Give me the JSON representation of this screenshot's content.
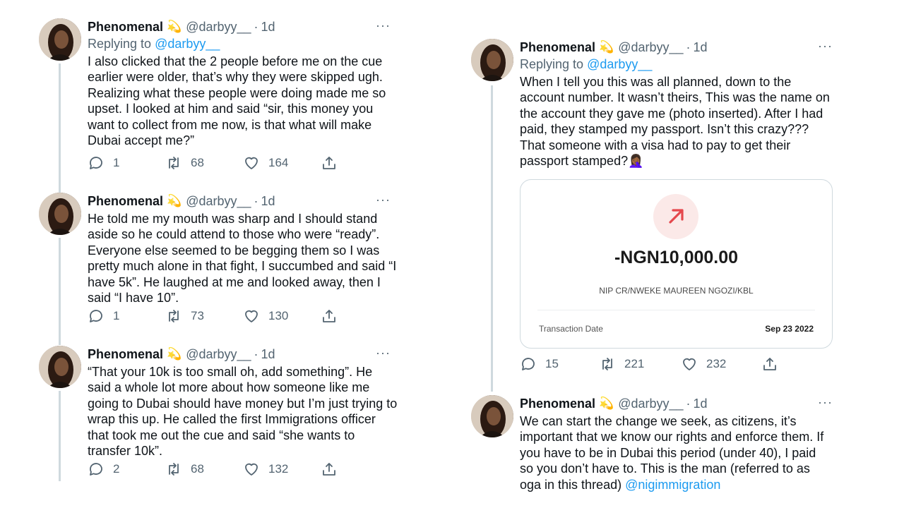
{
  "left_tweets": [
    {
      "name": "Phenomenal",
      "badge": "💫",
      "handle": "@darbyy__",
      "time": "1d",
      "replying_prefix": "Replying to ",
      "replying_to": "@darbyy__",
      "text": "I also clicked that the 2 people before me on the cue earlier were older, that’s why they were skipped ugh. Realizing what these people were doing made me so upset. I looked at him and said “sir, this money you want to collect from me now, is that what will make Dubai accept me?”",
      "replies": "1",
      "retweets": "68",
      "likes": "164"
    },
    {
      "name": "Phenomenal",
      "badge": "💫",
      "handle": "@darbyy__",
      "time": "1d",
      "text": "He told me my mouth was sharp and I should stand aside so he could attend to those who were “ready”. Everyone else seemed to be begging them so I was pretty much alone in that fight, I succumbed and said “I have 5k”. He laughed at me and looked away, then I said “I have 10”.",
      "replies": "1",
      "retweets": "73",
      "likes": "130"
    },
    {
      "name": "Phenomenal",
      "badge": "💫",
      "handle": "@darbyy__",
      "time": "1d",
      "text": "“That your 10k is too small oh, add something”. He said a whole lot more about how someone like me going to Dubai should have money but I’m just trying to wrap this up. He called the first Immigrations officer that took me out the cue and said “she wants to transfer 10k”.",
      "replies": "2",
      "retweets": "68",
      "likes": "132"
    }
  ],
  "right_tweets": [
    {
      "name": "Phenomenal",
      "badge": "💫",
      "handle": "@darbyy__",
      "time": "1d",
      "replying_prefix": "Replying to ",
      "replying_to": "@darbyy__",
      "text": "When I tell you this was all planned, down to the account number. It wasn’t theirs, This was the name on the account they gave me (photo inserted). After I had paid, they stamped my passport. Isn’t this crazy??? That someone with a visa had to pay to get their passport stamped?🤦🏾‍♀️",
      "card": {
        "amount": "-NGN10,000.00",
        "reference": "NIP CR/NWEKE MAUREEN NGOZI/KBL",
        "date_label": "Transaction Date",
        "date_value": "Sep 23 2022"
      },
      "replies": "15",
      "retweets": "221",
      "likes": "232"
    },
    {
      "name": "Phenomenal",
      "badge": "💫",
      "handle": "@darbyy__",
      "time": "1d",
      "text": "We can start the change we seek, as citizens, it’s important that we know our rights and enforce them. If you have to be in Dubai this period (under 40), I paid so you don’t have to. This is the man (referred to as oga in this thread) ",
      "mention": "@nigimmigration"
    }
  ],
  "ui": {
    "dot": "·",
    "more": "···"
  },
  "colors": {
    "link": "#1d9bf0",
    "secondary": "#536471",
    "arrow": "#e5484d"
  }
}
